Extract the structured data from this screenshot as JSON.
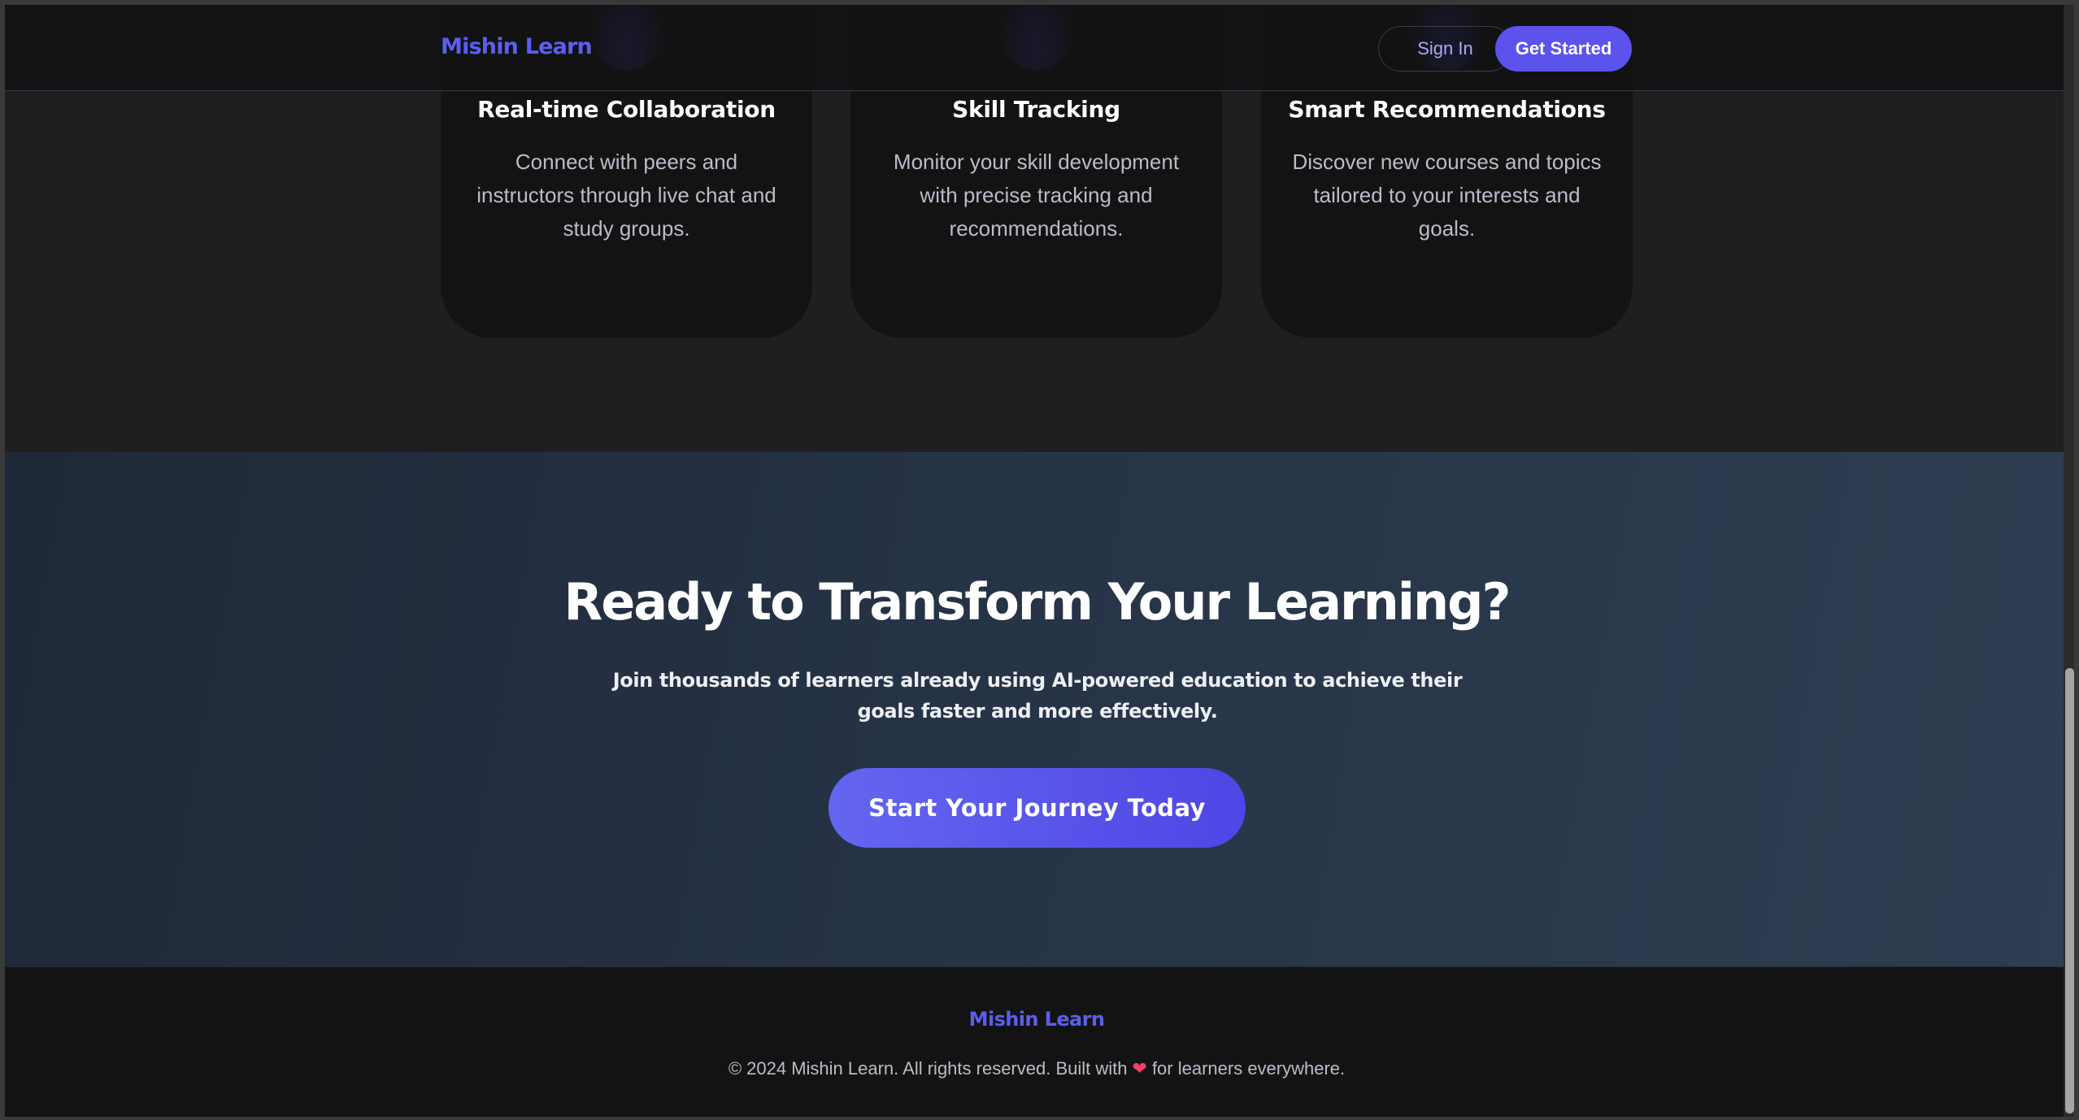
{
  "header": {
    "logo": "Mishin Learn",
    "sign_in": "Sign In",
    "get_started": "Get Started"
  },
  "features": [
    {
      "title": "Real-time Collaboration",
      "description": "Connect with peers and instructors through live chat and study groups."
    },
    {
      "title": "Skill Tracking",
      "description": "Monitor your skill development with precise tracking and recommendations."
    },
    {
      "title": "Smart Recommendations",
      "description": "Discover new courses and topics tailored to your interests and goals."
    }
  ],
  "cta": {
    "heading": "Ready to Transform Your Learning?",
    "subtext": "Join thousands of learners already using AI-powered education to achieve their goals faster and more effectively.",
    "button": "Start Your Journey Today"
  },
  "footer": {
    "logo": "Mishin Learn",
    "copyright_prefix": "© 2024 Mishin Learn. All rights reserved. Built with",
    "heart_icon": "heart-icon",
    "copyright_suffix": "for learners everywhere."
  },
  "colors": {
    "accent": "#5b5ef0",
    "button": "#5b53ec",
    "heart": "#f0406a",
    "background": "#1f1f21"
  }
}
